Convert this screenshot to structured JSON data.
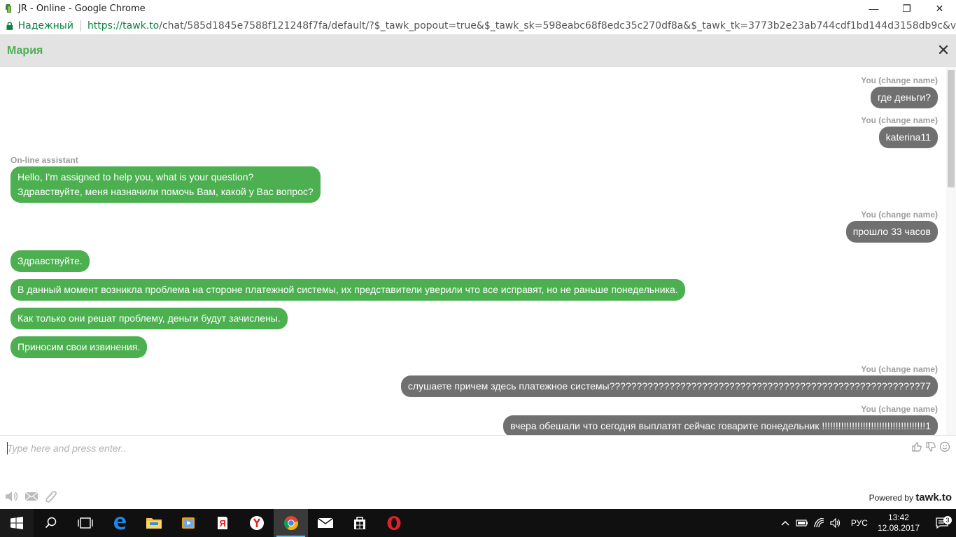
{
  "window": {
    "title": "JR - Online - Google Chrome",
    "controls": {
      "minimize": "—",
      "maximize": "❐",
      "close": "✕"
    }
  },
  "address": {
    "secure_label": "Надежный",
    "url_base": "https://tawk.to",
    "url_rest": "/chat/585d1845e7588f121248f7fa/default/?$_tawk_popout=true&$_tawk_sk=598eabc68f8edc35c270df8a&$_tawk_tk=3773b2e23ab744cdf1bd144d3158db9c&v=566"
  },
  "chat": {
    "agent_name": "Мария",
    "messages": [
      {
        "sender": "You (change name)",
        "text": "где деньги?"
      },
      {
        "sender": "You (change name)",
        "text": "katerina11"
      },
      {
        "sender": "On-line assistant",
        "line1": "Hello, I'm assigned to help you, what is your question?",
        "line2": "Здравствуйте, меня назначили помочь Вам, какой у Вас вопрос?"
      },
      {
        "sender": "You (change name)",
        "text": "прошло 33 часов"
      },
      {
        "text": "Здравствуйте."
      },
      {
        "text": "В данный момент возникла проблема на стороне платежной системы, их представители уверили что все исправят, но не раньше понедельника."
      },
      {
        "text": "Как только они решат проблему, деньги будут зачислены."
      },
      {
        "text": "Приносим свои извинения."
      },
      {
        "sender": "You (change name)",
        "text": "слушаете причем здесь платежное системы?????????????????????????????????????????????????????????77"
      },
      {
        "sender": "You (change name)",
        "text": "вчера обешали что сегодня выплатят сейчас говарите понедельник !!!!!!!!!!!!!!!!!!!!!!!!!!!!!!!!!!!!!!1"
      }
    ]
  },
  "input": {
    "placeholder": "Type here and press enter..",
    "powered_prefix": "Powered by",
    "powered_brand": "tawk.to"
  },
  "taskbar": {
    "language": "РУС",
    "time": "13:42",
    "date": "12.08.2017",
    "notification_count": "3"
  }
}
